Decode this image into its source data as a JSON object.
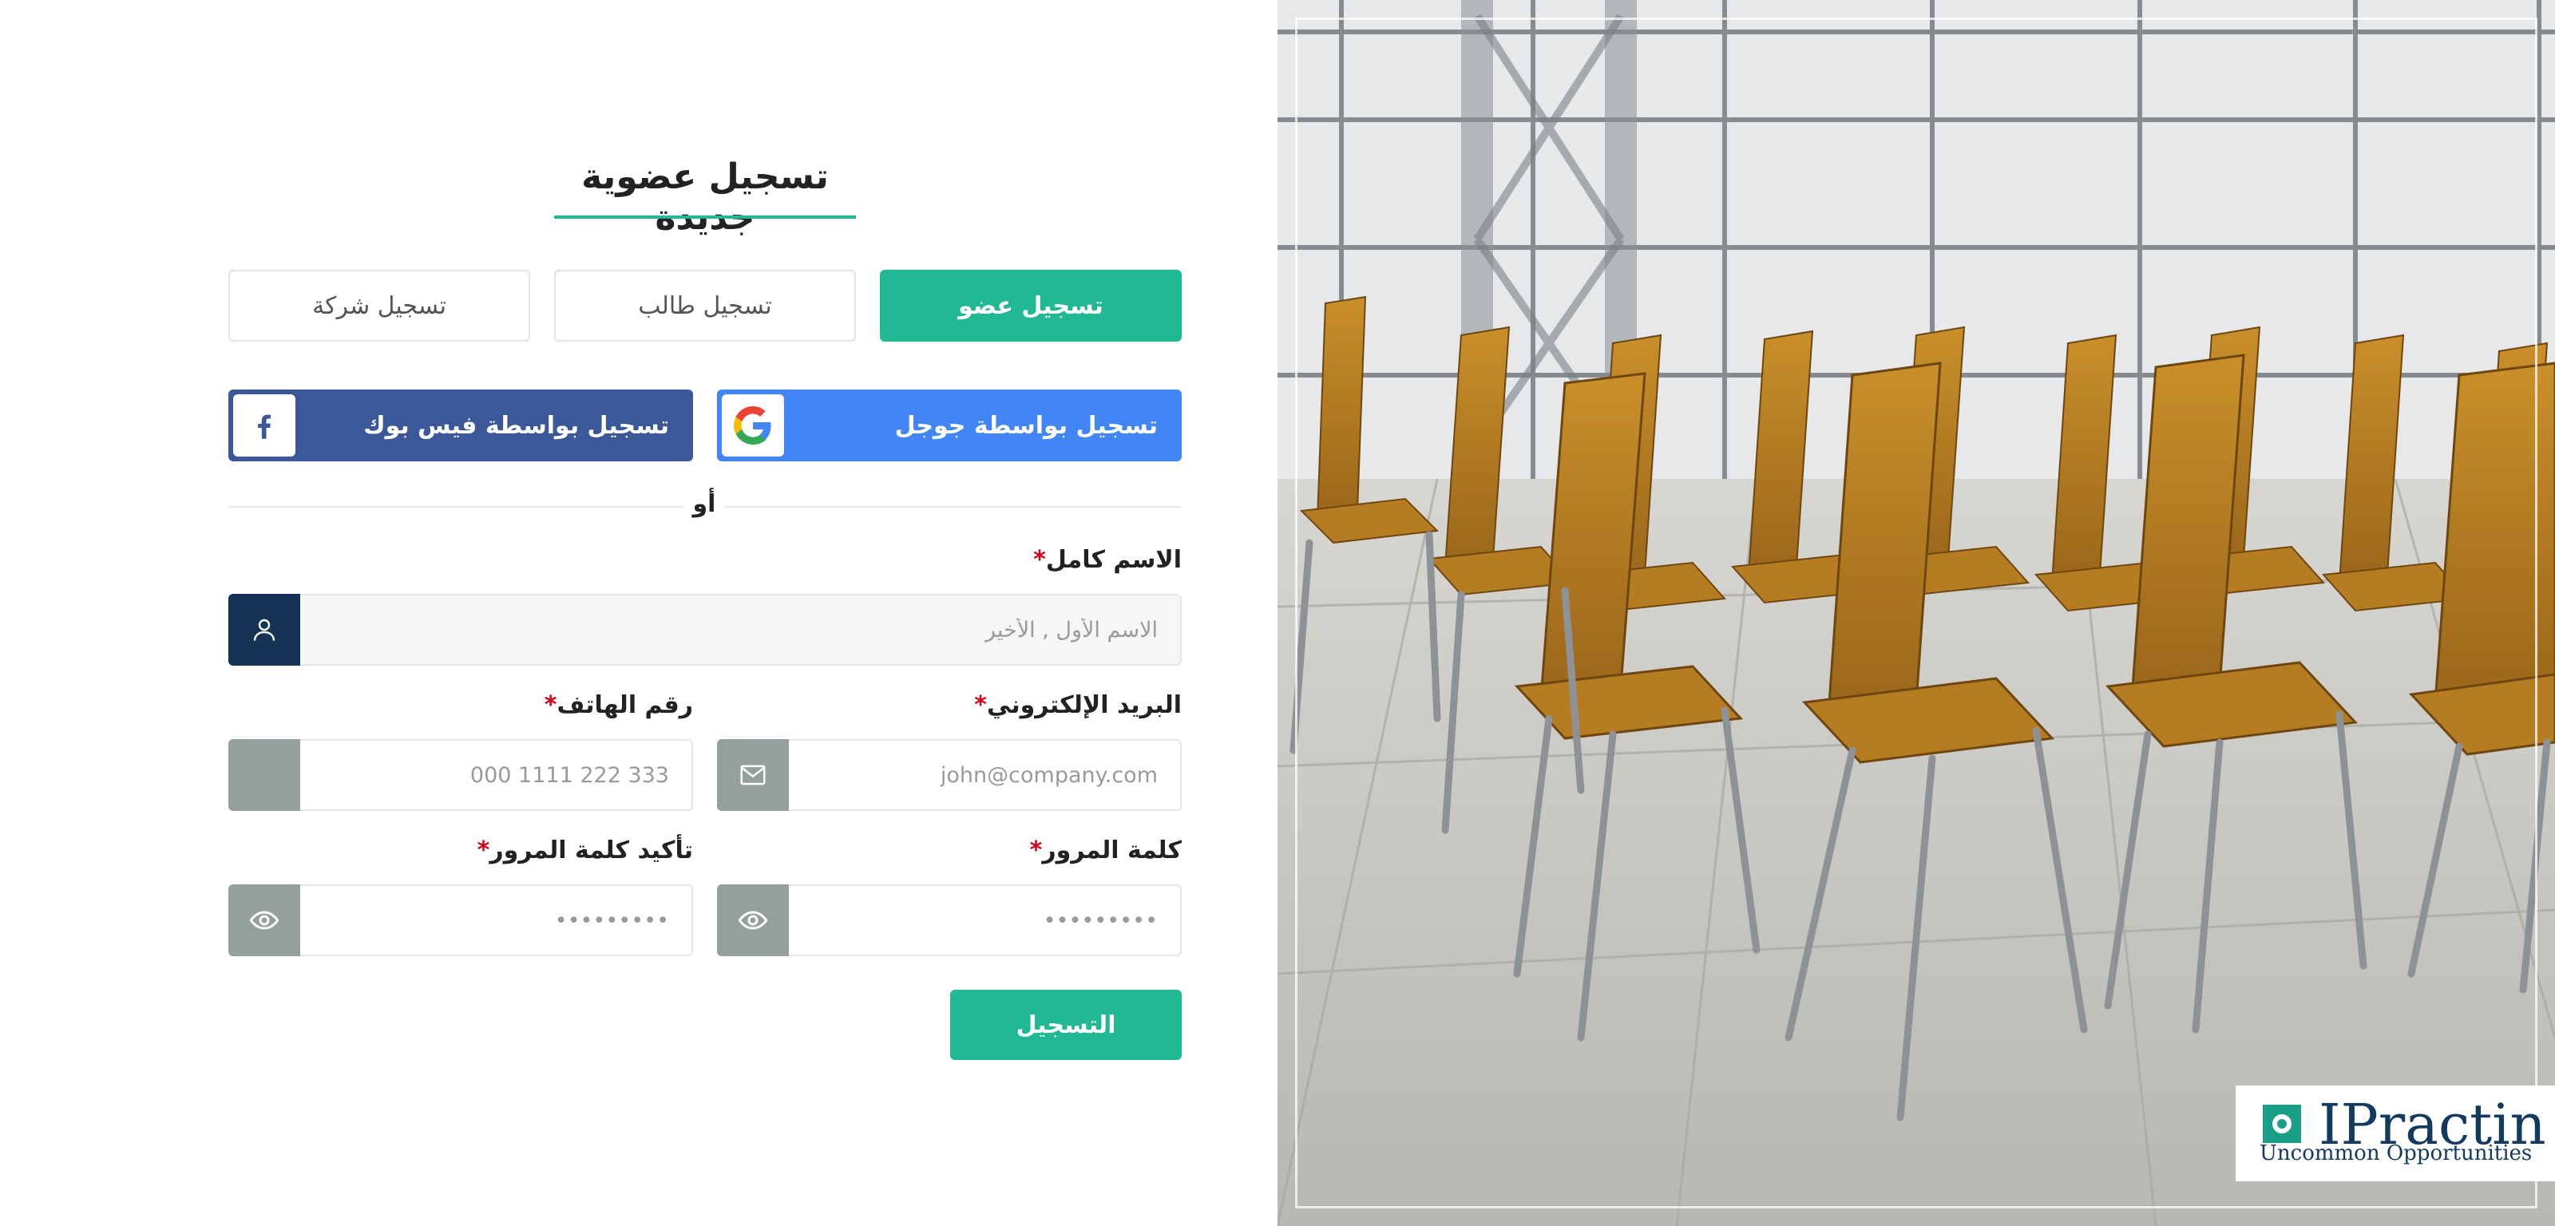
{
  "page": {
    "title": "تسجيل عضوية جديدة",
    "accent_color": "#20b993",
    "google_color": "#4285f4",
    "facebook_color": "#3b5998",
    "input_icon_dark": "#143355",
    "input_icon_grey": "#94a09c"
  },
  "tabs": [
    {
      "label": "تسجيل عضو",
      "active": true
    },
    {
      "label": "تسجيل طالب",
      "active": false
    },
    {
      "label": "تسجيل شركة",
      "active": false
    }
  ],
  "social": {
    "google_label": "تسجيل بواسطة جوجل",
    "google_icon": "google-icon",
    "facebook_label": "تسجيل بواسطة فيس بوك",
    "facebook_icon": "facebook-icon"
  },
  "divider": {
    "or_text": "أو"
  },
  "form": {
    "full_name": {
      "label": "الاسم كامل",
      "required_mark": "*",
      "placeholder": "الاسم الأول , الأخير",
      "icon": "user-icon"
    },
    "email": {
      "label": "البريد الإلكتروني",
      "required_mark": "*",
      "placeholder": "john@company.com",
      "icon": "mail-icon"
    },
    "phone": {
      "label": "رقم الهاتف",
      "required_mark": "*",
      "placeholder": "000 1111 222 333",
      "icon": "phone-icon"
    },
    "password": {
      "label": "كلمة المرور",
      "required_mark": "*",
      "placeholder": "•••••••••",
      "icon": "eye-icon"
    },
    "confirm_password": {
      "label": "تأكيد كلمة المرور",
      "required_mark": "*",
      "placeholder": "•••••••••",
      "icon": "eye-icon"
    },
    "submit_label": "التسجيل"
  },
  "brand": {
    "logo_text": "IPractin",
    "tagline": "Uncommon Opportunities"
  }
}
